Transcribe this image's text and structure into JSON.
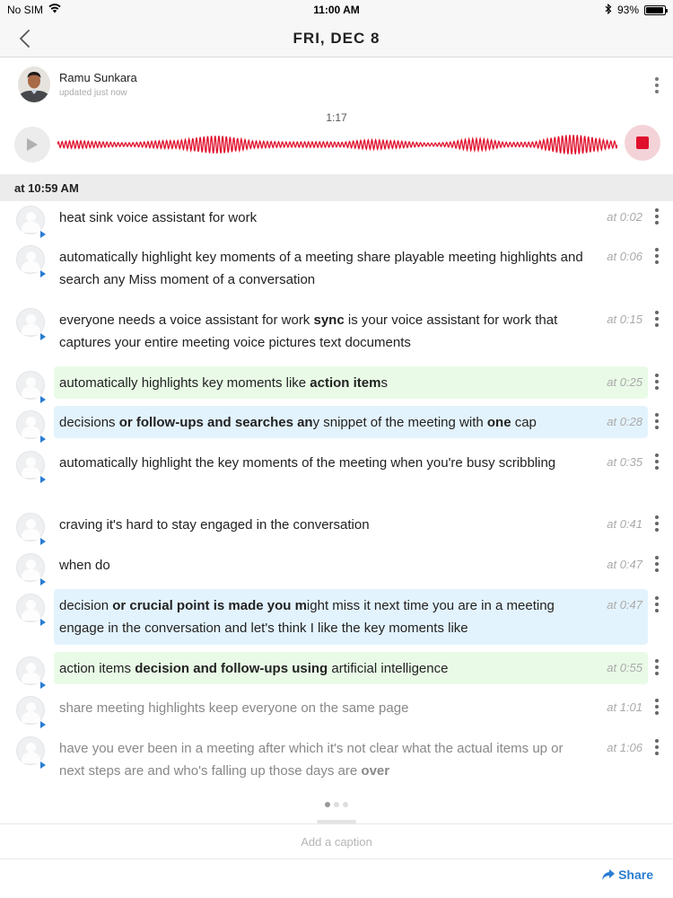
{
  "status_bar": {
    "carrier": "No SIM",
    "time": "11:00 AM",
    "battery": "93%",
    "battery_level": 0.93
  },
  "nav": {
    "title": "FRI, DEC 8"
  },
  "author": {
    "name": "Ramu Sunkara",
    "status": "updated just now"
  },
  "player": {
    "duration": "1:17",
    "state": "recording",
    "accent_color": "#e0102d"
  },
  "section": {
    "label": "at 10:59 AM"
  },
  "transcript": [
    {
      "time": "at 0:02",
      "style": "plain",
      "parts": [
        {
          "t": "heat sink voice assistant for work",
          "b": false
        }
      ]
    },
    {
      "time": "at 0:06",
      "style": "plain",
      "parts": [
        {
          "t": "automatically highlight key moments of a meeting share playable meeting highlights and search any Miss moment of a conversation",
          "b": false
        }
      ]
    },
    {
      "time": "at 0:15",
      "style": "plain",
      "parts": [
        {
          "t": "everyone needs a voice assistant for work ",
          "b": false
        },
        {
          "t": "sync",
          "b": true
        },
        {
          "t": " is your voice assistant for work that captures your entire meeting voice pictures text documents",
          "b": false
        }
      ]
    },
    {
      "time": "at 0:25",
      "style": "green",
      "parts": [
        {
          "t": "automatically highlights key moments like ",
          "b": false
        },
        {
          "t": "action item",
          "b": true
        },
        {
          "t": "s",
          "b": false
        }
      ]
    },
    {
      "time": "at 0:28",
      "style": "blue",
      "parts": [
        {
          "t": "decisions ",
          "b": false
        },
        {
          "t": "or follow-ups and searches an",
          "b": true
        },
        {
          "t": "y snippet of the meeting with ",
          "b": false
        },
        {
          "t": "one",
          "b": true
        },
        {
          "t": " cap",
          "b": false
        }
      ]
    },
    {
      "time": "at 0:35",
      "style": "plain",
      "parts": [
        {
          "t": "automatically highlight the key moments of the meeting when you're busy scribbling",
          "b": false
        }
      ]
    },
    {
      "time": "at 0:41",
      "style": "plain",
      "parts": [
        {
          "t": "craving it's hard to stay engaged in the conversation",
          "b": false
        }
      ]
    },
    {
      "time": "at 0:47",
      "style": "plain",
      "parts": [
        {
          "t": "when do",
          "b": false
        }
      ]
    },
    {
      "time": "at 0:47",
      "style": "blue",
      "parts": [
        {
          "t": "decision ",
          "b": false
        },
        {
          "t": "or crucial point is made you m",
          "b": true
        },
        {
          "t": "ight miss it next time you are in a meeting engage in the conversation and let's think I like the key moments like",
          "b": false
        }
      ]
    },
    {
      "time": "at 0:55",
      "style": "green",
      "parts": [
        {
          "t": "action items ",
          "b": false
        },
        {
          "t": "decision and follow-ups using",
          "b": true
        },
        {
          "t": " artificial intelligence",
          "b": false
        }
      ]
    },
    {
      "time": "at 1:01",
      "style": "gray",
      "parts": [
        {
          "t": "share meeting highlights keep everyone on the same page",
          "b": false
        }
      ]
    },
    {
      "time": "at 1:06",
      "style": "gray",
      "parts": [
        {
          "t": " have you ever been in a meeting after which it's not clear what the actual items up or next steps are and who's falling up those days are ",
          "b": false
        },
        {
          "t": "over",
          "b": true
        }
      ]
    }
  ],
  "caption": {
    "placeholder": "Add a caption"
  },
  "share": {
    "label": "Share"
  },
  "colors": {
    "accent_blue": "#2a7dd1",
    "highlight_green": "#e9fbe7",
    "highlight_blue": "#e3f3fd",
    "record_red": "#e0102d"
  }
}
